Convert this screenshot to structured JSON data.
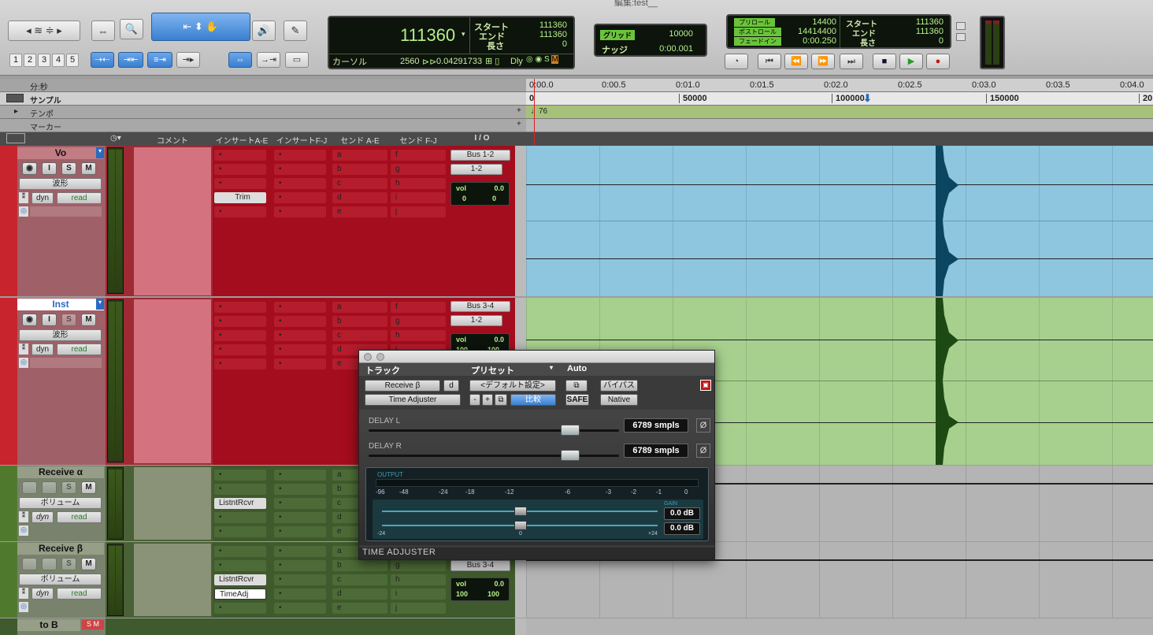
{
  "window": {
    "title": "編集:test__"
  },
  "toolbar": {
    "nums": [
      "1",
      "2",
      "3",
      "4",
      "5"
    ],
    "counter": {
      "main": "111360",
      "start_label": "スタート",
      "end_label": "エンド",
      "length_label": "長さ",
      "start": "111360",
      "end": "111360",
      "length": "0",
      "cursor_label": "カーソル",
      "cursor_val": "2560",
      "cursor_time": "0.04291733",
      "dly": "Dly"
    },
    "grid": {
      "grid_label": "グリッド",
      "grid_val": "10000",
      "nudge_label": "ナッジ",
      "nudge_val": "0:00.001"
    },
    "pre": {
      "preroll_label": "プリロール",
      "preroll": "14400",
      "postroll_label": "ポストロール",
      "postroll": "14414400",
      "fadein_label": "フェードイン",
      "fadein": "0:00.250",
      "start_label": "スタート",
      "end_label": "エンド",
      "length_label": "長さ",
      "start": "111360",
      "end": "111360",
      "length": "0"
    }
  },
  "rulers": {
    "minsec_label": "分:秒",
    "sample_label": "サンプル",
    "tempo_label": "テンポ",
    "marker_label": "マーカー",
    "minsec_ticks": [
      "0:00.0",
      "0:00.5",
      "0:01.0",
      "0:01.5",
      "0:02.0",
      "0:02.5",
      "0:03.0",
      "0:03.5",
      "0:04.0"
    ],
    "sample_ticks": [
      "0",
      "50000",
      "100000",
      "150000",
      "20"
    ],
    "tempo_value": "♩76"
  },
  "columns": {
    "comment": "コメント",
    "inserts_ae": "インサートA-E",
    "inserts_fj": "インサートF-J",
    "sends_ae": "センド A-E",
    "sends_fj": "センド F-J",
    "io": "I / O"
  },
  "tracks": [
    {
      "name": "Vo",
      "view": "波形",
      "dyn": "dyn",
      "auto": "read",
      "insert": "Trim",
      "sends_a": [
        "a",
        "b",
        "c",
        "d",
        "e"
      ],
      "sends_f": [
        "f",
        "g",
        "h",
        "i",
        "j"
      ],
      "io_out": "Bus 1-2",
      "io_in": "1-2",
      "vol_label": "vol",
      "vol": "0.0",
      "pan_l": "0",
      "pan_r": "0"
    },
    {
      "name": "Inst",
      "view": "波形",
      "dyn": "dyn",
      "auto": "read",
      "sends_a": [
        "a",
        "b",
        "c",
        "d",
        "e"
      ],
      "sends_f": [
        "f",
        "g",
        "h",
        "i",
        "j"
      ],
      "io_out": "Bus 3-4",
      "io_in": "1-2",
      "vol_label": "vol",
      "vol": "0.0",
      "pan_l": "100",
      "pan_r": "100"
    },
    {
      "name": "Receive α",
      "view": "ボリューム",
      "dyn": "dyn",
      "auto": "read",
      "insert": "ListntRcvr",
      "sends_a": [
        "a",
        "b",
        "c",
        "d",
        "e"
      ]
    },
    {
      "name": "Receive β",
      "view": "ボリューム",
      "dyn": "dyn",
      "auto": "read",
      "insert": "ListntRcvr",
      "insert2": "TimeAdj",
      "sends_a": [
        "a",
        "b",
        "c",
        "d",
        "e"
      ],
      "sends_f": [
        "f",
        "g",
        "h",
        "i",
        "j"
      ],
      "io_out": "Bus 3-4",
      "vol_label": "vol",
      "vol": "0.0",
      "pan_l": "100",
      "pan_r": "100"
    },
    {
      "name": "to B"
    }
  ],
  "plugin": {
    "track_label": "トラック",
    "preset_label": "プリセット",
    "auto_label": "Auto",
    "track": "Receive β",
    "track_suffix": "d",
    "plugin_name": "Time Adjuster",
    "preset": "<デフォルト設定>",
    "minus": "-",
    "plus": "+",
    "compare": "比較",
    "bypass": "バイパス",
    "safe": "SAFE",
    "native": "Native",
    "delay_l_label": "DELAY L",
    "delay_l_value": "6789 smpls",
    "delay_r_label": "DELAY R",
    "delay_r_value": "6789 smpls",
    "phase_symbol": "Ø",
    "output_label": "OUTPUT",
    "meter_scale": [
      "-96",
      "-48",
      "-24",
      "-18",
      "-12",
      "-6",
      "-3",
      "-2",
      "-1",
      "0"
    ],
    "gain_label": "GAIN",
    "gain_l": "0.0 dB",
    "gain_r": "0.0 dB",
    "gain_scale_min": "-24",
    "gain_scale_mid": "0",
    "gain_scale_max": "+24",
    "footer": "TIME ADJUSTER"
  },
  "colors": {
    "vo_bg": "#8ec6e0",
    "inst_bg": "#a7d08e",
    "insert_red": "#a30d1d",
    "aux_green": "#3f5a2c"
  }
}
